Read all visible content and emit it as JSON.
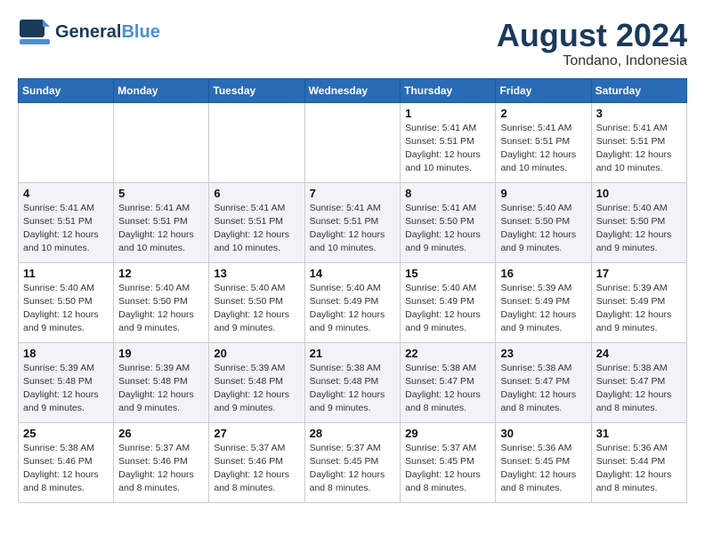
{
  "header": {
    "logo_line1": "General",
    "logo_line2": "Blue",
    "month_year": "August 2024",
    "location": "Tondano, Indonesia"
  },
  "days_of_week": [
    "Sunday",
    "Monday",
    "Tuesday",
    "Wednesday",
    "Thursday",
    "Friday",
    "Saturday"
  ],
  "weeks": [
    [
      {
        "day": "",
        "info": ""
      },
      {
        "day": "",
        "info": ""
      },
      {
        "day": "",
        "info": ""
      },
      {
        "day": "",
        "info": ""
      },
      {
        "day": "1",
        "info": "Sunrise: 5:41 AM\nSunset: 5:51 PM\nDaylight: 12 hours\nand 10 minutes."
      },
      {
        "day": "2",
        "info": "Sunrise: 5:41 AM\nSunset: 5:51 PM\nDaylight: 12 hours\nand 10 minutes."
      },
      {
        "day": "3",
        "info": "Sunrise: 5:41 AM\nSunset: 5:51 PM\nDaylight: 12 hours\nand 10 minutes."
      }
    ],
    [
      {
        "day": "4",
        "info": "Sunrise: 5:41 AM\nSunset: 5:51 PM\nDaylight: 12 hours\nand 10 minutes."
      },
      {
        "day": "5",
        "info": "Sunrise: 5:41 AM\nSunset: 5:51 PM\nDaylight: 12 hours\nand 10 minutes."
      },
      {
        "day": "6",
        "info": "Sunrise: 5:41 AM\nSunset: 5:51 PM\nDaylight: 12 hours\nand 10 minutes."
      },
      {
        "day": "7",
        "info": "Sunrise: 5:41 AM\nSunset: 5:51 PM\nDaylight: 12 hours\nand 10 minutes."
      },
      {
        "day": "8",
        "info": "Sunrise: 5:41 AM\nSunset: 5:50 PM\nDaylight: 12 hours\nand 9 minutes."
      },
      {
        "day": "9",
        "info": "Sunrise: 5:40 AM\nSunset: 5:50 PM\nDaylight: 12 hours\nand 9 minutes."
      },
      {
        "day": "10",
        "info": "Sunrise: 5:40 AM\nSunset: 5:50 PM\nDaylight: 12 hours\nand 9 minutes."
      }
    ],
    [
      {
        "day": "11",
        "info": "Sunrise: 5:40 AM\nSunset: 5:50 PM\nDaylight: 12 hours\nand 9 minutes."
      },
      {
        "day": "12",
        "info": "Sunrise: 5:40 AM\nSunset: 5:50 PM\nDaylight: 12 hours\nand 9 minutes."
      },
      {
        "day": "13",
        "info": "Sunrise: 5:40 AM\nSunset: 5:50 PM\nDaylight: 12 hours\nand 9 minutes."
      },
      {
        "day": "14",
        "info": "Sunrise: 5:40 AM\nSunset: 5:49 PM\nDaylight: 12 hours\nand 9 minutes."
      },
      {
        "day": "15",
        "info": "Sunrise: 5:40 AM\nSunset: 5:49 PM\nDaylight: 12 hours\nand 9 minutes."
      },
      {
        "day": "16",
        "info": "Sunrise: 5:39 AM\nSunset: 5:49 PM\nDaylight: 12 hours\nand 9 minutes."
      },
      {
        "day": "17",
        "info": "Sunrise: 5:39 AM\nSunset: 5:49 PM\nDaylight: 12 hours\nand 9 minutes."
      }
    ],
    [
      {
        "day": "18",
        "info": "Sunrise: 5:39 AM\nSunset: 5:48 PM\nDaylight: 12 hours\nand 9 minutes."
      },
      {
        "day": "19",
        "info": "Sunrise: 5:39 AM\nSunset: 5:48 PM\nDaylight: 12 hours\nand 9 minutes."
      },
      {
        "day": "20",
        "info": "Sunrise: 5:39 AM\nSunset: 5:48 PM\nDaylight: 12 hours\nand 9 minutes."
      },
      {
        "day": "21",
        "info": "Sunrise: 5:38 AM\nSunset: 5:48 PM\nDaylight: 12 hours\nand 9 minutes."
      },
      {
        "day": "22",
        "info": "Sunrise: 5:38 AM\nSunset: 5:47 PM\nDaylight: 12 hours\nand 8 minutes."
      },
      {
        "day": "23",
        "info": "Sunrise: 5:38 AM\nSunset: 5:47 PM\nDaylight: 12 hours\nand 8 minutes."
      },
      {
        "day": "24",
        "info": "Sunrise: 5:38 AM\nSunset: 5:47 PM\nDaylight: 12 hours\nand 8 minutes."
      }
    ],
    [
      {
        "day": "25",
        "info": "Sunrise: 5:38 AM\nSunset: 5:46 PM\nDaylight: 12 hours\nand 8 minutes."
      },
      {
        "day": "26",
        "info": "Sunrise: 5:37 AM\nSunset: 5:46 PM\nDaylight: 12 hours\nand 8 minutes."
      },
      {
        "day": "27",
        "info": "Sunrise: 5:37 AM\nSunset: 5:46 PM\nDaylight: 12 hours\nand 8 minutes."
      },
      {
        "day": "28",
        "info": "Sunrise: 5:37 AM\nSunset: 5:45 PM\nDaylight: 12 hours\nand 8 minutes."
      },
      {
        "day": "29",
        "info": "Sunrise: 5:37 AM\nSunset: 5:45 PM\nDaylight: 12 hours\nand 8 minutes."
      },
      {
        "day": "30",
        "info": "Sunrise: 5:36 AM\nSunset: 5:45 PM\nDaylight: 12 hours\nand 8 minutes."
      },
      {
        "day": "31",
        "info": "Sunrise: 5:36 AM\nSunset: 5:44 PM\nDaylight: 12 hours\nand 8 minutes."
      }
    ]
  ]
}
